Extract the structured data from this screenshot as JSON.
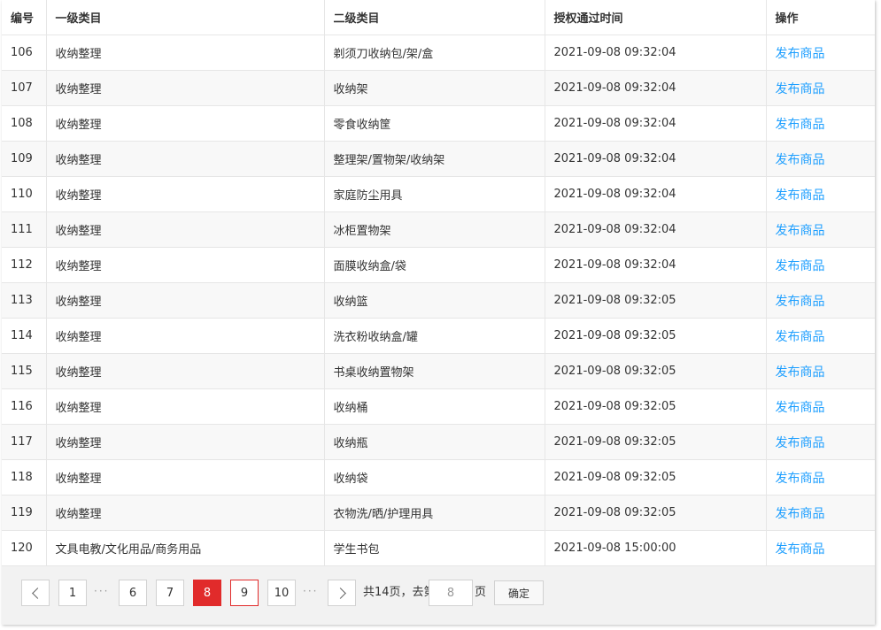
{
  "table": {
    "headers": [
      "编号",
      "一级类目",
      "二级类目",
      "授权通过时间",
      "操作"
    ],
    "rows": [
      {
        "id": "106",
        "level1": "收纳整理",
        "level2": "剃须刀收纳包/架/盒",
        "time": "2021-09-08 09:32:04",
        "action": "发布商品"
      },
      {
        "id": "107",
        "level1": "收纳整理",
        "level2": "收纳架",
        "time": "2021-09-08 09:32:04",
        "action": "发布商品"
      },
      {
        "id": "108",
        "level1": "收纳整理",
        "level2": "零食收纳筐",
        "time": "2021-09-08 09:32:04",
        "action": "发布商品"
      },
      {
        "id": "109",
        "level1": "收纳整理",
        "level2": "整理架/置物架/收纳架",
        "time": "2021-09-08 09:32:04",
        "action": "发布商品"
      },
      {
        "id": "110",
        "level1": "收纳整理",
        "level2": "家庭防尘用具",
        "time": "2021-09-08 09:32:04",
        "action": "发布商品"
      },
      {
        "id": "111",
        "level1": "收纳整理",
        "level2": "冰柜置物架",
        "time": "2021-09-08 09:32:04",
        "action": "发布商品"
      },
      {
        "id": "112",
        "level1": "收纳整理",
        "level2": "面膜收纳盒/袋",
        "time": "2021-09-08 09:32:04",
        "action": "发布商品"
      },
      {
        "id": "113",
        "level1": "收纳整理",
        "level2": "收纳篮",
        "time": "2021-09-08 09:32:05",
        "action": "发布商品"
      },
      {
        "id": "114",
        "level1": "收纳整理",
        "level2": "洗衣粉收纳盒/罐",
        "time": "2021-09-08 09:32:05",
        "action": "发布商品"
      },
      {
        "id": "115",
        "level1": "收纳整理",
        "level2": "书桌收纳置物架",
        "time": "2021-09-08 09:32:05",
        "action": "发布商品"
      },
      {
        "id": "116",
        "level1": "收纳整理",
        "level2": "收纳桶",
        "time": "2021-09-08 09:32:05",
        "action": "发布商品"
      },
      {
        "id": "117",
        "level1": "收纳整理",
        "level2": "收纳瓶",
        "time": "2021-09-08 09:32:05",
        "action": "发布商品"
      },
      {
        "id": "118",
        "level1": "收纳整理",
        "level2": "收纳袋",
        "time": "2021-09-08 09:32:05",
        "action": "发布商品"
      },
      {
        "id": "119",
        "level1": "收纳整理",
        "level2": "衣物洗/晒/护理用具",
        "time": "2021-09-08 09:32:05",
        "action": "发布商品"
      },
      {
        "id": "120",
        "level1": "文具电教/文化用品/商务用品",
        "level2": "学生书包",
        "time": "2021-09-08 15:00:00",
        "action": "发布商品"
      }
    ]
  },
  "pagination": {
    "pages": [
      "1",
      "6",
      "7",
      "8",
      "9",
      "10"
    ],
    "current_page": "8",
    "ellipsis": "···",
    "total_text": "共14页，去第",
    "page_suffix": "页",
    "jump_value": "8",
    "confirm_label": "确定"
  },
  "colors": {
    "link": "#1e9fff",
    "current_page": "#e12b2b"
  }
}
